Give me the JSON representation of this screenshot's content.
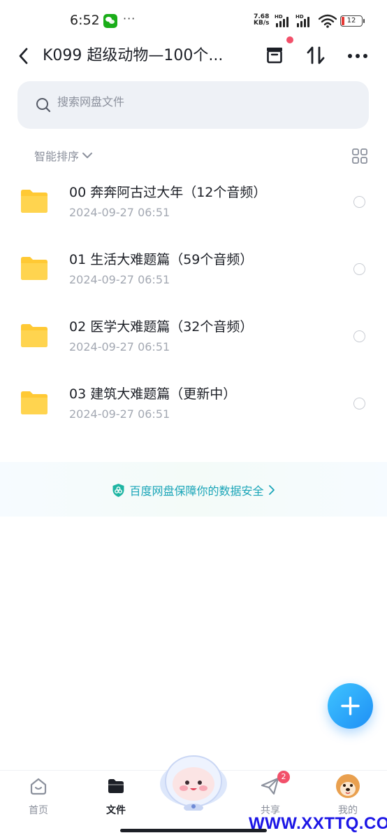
{
  "status_bar": {
    "time": "6:52",
    "more": "···",
    "net_speed_value": "7.68",
    "net_speed_unit": "KB/s",
    "signal_tag": "HD",
    "battery_level": "12"
  },
  "header": {
    "title": "K099 超级动物—100个..."
  },
  "search": {
    "placeholder": "搜索网盘文件"
  },
  "sort": {
    "label": "智能排序"
  },
  "files": [
    {
      "name": "00 奔奔阿古过大年（12个音频）",
      "date": "2024-09-27   06:51"
    },
    {
      "name": "01 生活大难题篇（59个音频）",
      "date": "2024-09-27   06:51"
    },
    {
      "name": "02 医学大难题篇（32个音频）",
      "date": "2024-09-27   06:51"
    },
    {
      "name": "03 建筑大难题篇（更新中）",
      "date": "2024-09-27   06:51"
    }
  ],
  "security_banner": {
    "text": "百度网盘保障你的数据安全"
  },
  "bottom_nav": {
    "home_label": "首页",
    "files_label": "文件",
    "share_label": "共享",
    "share_badge": "2",
    "me_label": "我的"
  },
  "watermark": "WWW.XXTTQ.COM",
  "colors": {
    "accent": "#1e8ff5",
    "folder": "#ffc934",
    "security_text": "#1aa5b8",
    "badge": "#f2506a"
  }
}
